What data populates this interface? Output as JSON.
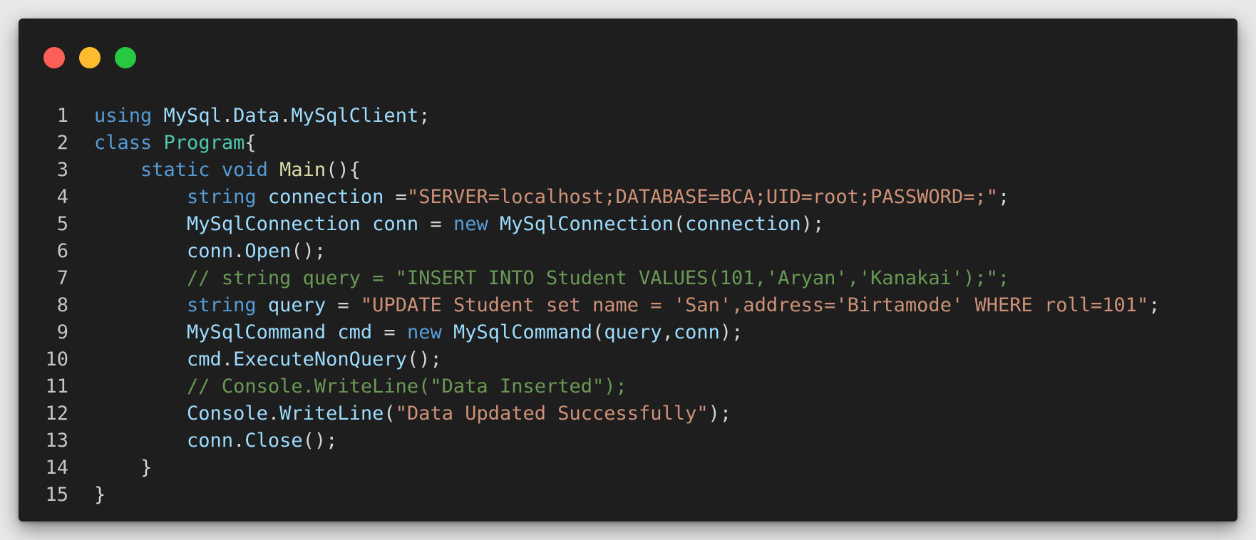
{
  "window": {
    "controls": [
      {
        "name": "close",
        "color": "#ff5f57"
      },
      {
        "name": "minimize",
        "color": "#febc2e"
      },
      {
        "name": "maximize",
        "color": "#28c840"
      }
    ]
  },
  "code": {
    "language": "C#",
    "lines": [
      {
        "number": "1",
        "tokens": [
          {
            "t": "using",
            "c": "kw"
          },
          {
            "t": " ",
            "c": "pn"
          },
          {
            "t": "MySql",
            "c": "id"
          },
          {
            "t": ".",
            "c": "pn"
          },
          {
            "t": "Data",
            "c": "id"
          },
          {
            "t": ".",
            "c": "pn"
          },
          {
            "t": "MySqlClient",
            "c": "id"
          },
          {
            "t": ";",
            "c": "pn"
          }
        ]
      },
      {
        "number": "2",
        "tokens": [
          {
            "t": "class",
            "c": "kw"
          },
          {
            "t": " ",
            "c": "pn"
          },
          {
            "t": "Program",
            "c": "cls"
          },
          {
            "t": "{",
            "c": "pn"
          }
        ]
      },
      {
        "number": "3",
        "tokens": [
          {
            "t": "    ",
            "c": "pn"
          },
          {
            "t": "static",
            "c": "kw"
          },
          {
            "t": " ",
            "c": "pn"
          },
          {
            "t": "void",
            "c": "kw"
          },
          {
            "t": " ",
            "c": "pn"
          },
          {
            "t": "Main",
            "c": "fn"
          },
          {
            "t": "(){",
            "c": "pn"
          }
        ]
      },
      {
        "number": "4",
        "tokens": [
          {
            "t": "        ",
            "c": "pn"
          },
          {
            "t": "string",
            "c": "kw"
          },
          {
            "t": " ",
            "c": "pn"
          },
          {
            "t": "connection",
            "c": "id"
          },
          {
            "t": " =",
            "c": "pn"
          },
          {
            "t": "\"SERVER=localhost;DATABASE=BCA;UID=root;PASSWORD=;\"",
            "c": "str"
          },
          {
            "t": ";",
            "c": "pn"
          }
        ]
      },
      {
        "number": "5",
        "tokens": [
          {
            "t": "        ",
            "c": "pn"
          },
          {
            "t": "MySqlConnection",
            "c": "id"
          },
          {
            "t": " ",
            "c": "pn"
          },
          {
            "t": "conn",
            "c": "id"
          },
          {
            "t": " = ",
            "c": "pn"
          },
          {
            "t": "new",
            "c": "kw"
          },
          {
            "t": " ",
            "c": "pn"
          },
          {
            "t": "MySqlConnection",
            "c": "id"
          },
          {
            "t": "(",
            "c": "pn"
          },
          {
            "t": "connection",
            "c": "id"
          },
          {
            "t": ");",
            "c": "pn"
          }
        ]
      },
      {
        "number": "6",
        "tokens": [
          {
            "t": "        ",
            "c": "pn"
          },
          {
            "t": "conn",
            "c": "id"
          },
          {
            "t": ".",
            "c": "pn"
          },
          {
            "t": "Open",
            "c": "id"
          },
          {
            "t": "();",
            "c": "pn"
          }
        ]
      },
      {
        "number": "7",
        "tokens": [
          {
            "t": "        ",
            "c": "pn"
          },
          {
            "t": "// string query = \"INSERT INTO Student VALUES(101,'Aryan','Kanakai');\";",
            "c": "cm"
          }
        ]
      },
      {
        "number": "8",
        "tokens": [
          {
            "t": "        ",
            "c": "pn"
          },
          {
            "t": "string",
            "c": "kw"
          },
          {
            "t": " ",
            "c": "pn"
          },
          {
            "t": "query",
            "c": "id"
          },
          {
            "t": " = ",
            "c": "pn"
          },
          {
            "t": "\"UPDATE Student set name = 'San',address='Birtamode' WHERE roll=101\"",
            "c": "str"
          },
          {
            "t": ";",
            "c": "pn"
          }
        ]
      },
      {
        "number": "9",
        "tokens": [
          {
            "t": "        ",
            "c": "pn"
          },
          {
            "t": "MySqlCommand",
            "c": "id"
          },
          {
            "t": " ",
            "c": "pn"
          },
          {
            "t": "cmd",
            "c": "id"
          },
          {
            "t": " = ",
            "c": "pn"
          },
          {
            "t": "new",
            "c": "kw"
          },
          {
            "t": " ",
            "c": "pn"
          },
          {
            "t": "MySqlCommand",
            "c": "id"
          },
          {
            "t": "(",
            "c": "pn"
          },
          {
            "t": "query",
            "c": "id"
          },
          {
            "t": ",",
            "c": "pn"
          },
          {
            "t": "conn",
            "c": "id"
          },
          {
            "t": ");",
            "c": "pn"
          }
        ]
      },
      {
        "number": "10",
        "tokens": [
          {
            "t": "        ",
            "c": "pn"
          },
          {
            "t": "cmd",
            "c": "id"
          },
          {
            "t": ".",
            "c": "pn"
          },
          {
            "t": "ExecuteNonQuery",
            "c": "id"
          },
          {
            "t": "();",
            "c": "pn"
          }
        ]
      },
      {
        "number": "11",
        "tokens": [
          {
            "t": "        ",
            "c": "pn"
          },
          {
            "t": "// Console.WriteLine(\"Data Inserted\");",
            "c": "cm"
          }
        ]
      },
      {
        "number": "12",
        "tokens": [
          {
            "t": "        ",
            "c": "pn"
          },
          {
            "t": "Console",
            "c": "id"
          },
          {
            "t": ".",
            "c": "pn"
          },
          {
            "t": "WriteLine",
            "c": "id"
          },
          {
            "t": "(",
            "c": "pn"
          },
          {
            "t": "\"Data Updated Successfully\"",
            "c": "str"
          },
          {
            "t": ");",
            "c": "pn"
          }
        ]
      },
      {
        "number": "13",
        "tokens": [
          {
            "t": "        ",
            "c": "pn"
          },
          {
            "t": "conn",
            "c": "id"
          },
          {
            "t": ".",
            "c": "pn"
          },
          {
            "t": "Close",
            "c": "id"
          },
          {
            "t": "();",
            "c": "pn"
          }
        ]
      },
      {
        "number": "14",
        "tokens": [
          {
            "t": "    ",
            "c": "pn"
          },
          {
            "t": "}",
            "c": "pn"
          }
        ]
      },
      {
        "number": "15",
        "tokens": [
          {
            "t": "}",
            "c": "pn"
          }
        ]
      }
    ]
  }
}
